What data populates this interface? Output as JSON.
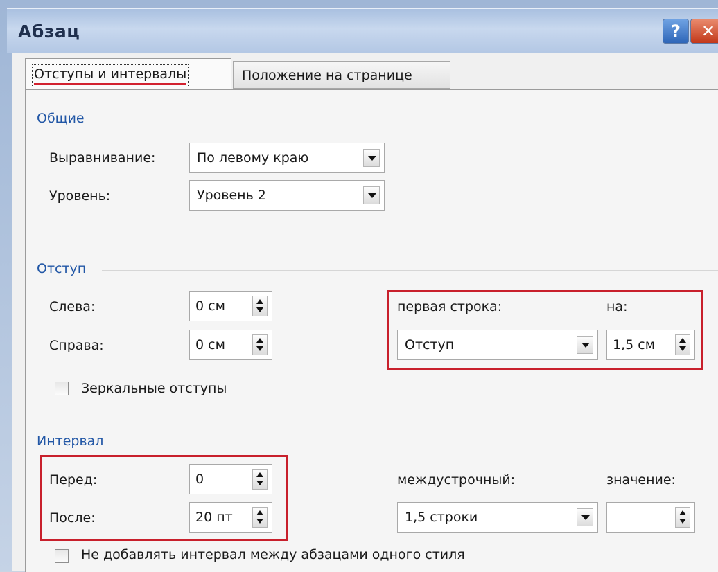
{
  "window": {
    "title": "Абзац",
    "help_glyph": "?",
    "close_glyph": "✕"
  },
  "tabs": [
    {
      "label": "Отступы и интервалы",
      "active": true
    },
    {
      "label": "Положение на странице",
      "active": false
    }
  ],
  "general": {
    "heading": "Общие",
    "alignment_label": "Выравнивание:",
    "alignment_value": "По левому краю",
    "level_label": "Уровень:",
    "level_value": "Уровень 2"
  },
  "indent": {
    "heading": "Отступ",
    "left_label": "Слева:",
    "left_value": "0 см",
    "right_label": "Справа:",
    "right_value": "0 см",
    "first_line_label": "первая строка:",
    "first_line_value": "Отступ",
    "by_label": "на:",
    "by_value": "1,5 см",
    "mirror_label": "Зеркальные отступы",
    "mirror_checked": false
  },
  "spacing": {
    "heading": "Интервал",
    "before_label": "Перед:",
    "before_value": "0",
    "after_label": "После:",
    "after_value": "20 пт",
    "line_spacing_label": "междустрочный:",
    "line_spacing_value": "1,5 строки",
    "at_label": "значение:",
    "at_value": "",
    "dont_add_label": "Не добавлять интервал между абзацами одного стиля",
    "dont_add_checked": false
  },
  "colors": {
    "highlight": "#c8202c",
    "group_heading": "#2257a6"
  }
}
